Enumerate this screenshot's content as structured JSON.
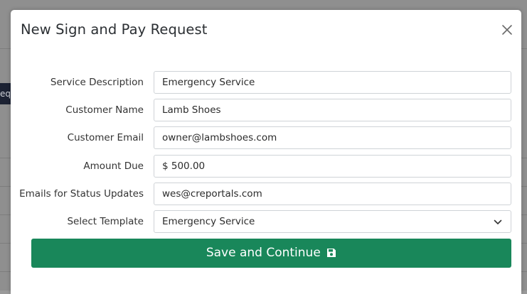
{
  "modal": {
    "title": "New Sign and Pay Request",
    "close_icon": "close-icon"
  },
  "form": {
    "service_description": {
      "label": "Service Description",
      "value": "Emergency Service"
    },
    "customer_name": {
      "label": "Customer Name",
      "value": "Lamb Shoes"
    },
    "customer_email": {
      "label": "Customer Email",
      "value": "owner@lambshoes.com"
    },
    "amount_due": {
      "label": "Amount Due",
      "value": "$ 500.00"
    },
    "status_emails": {
      "label": "Emails for Status Updates",
      "value": "wes@creportals.com"
    },
    "template": {
      "label": "Select Template",
      "selected": "Emergency Service"
    }
  },
  "actions": {
    "save_label": "Save and Continue",
    "save_icon": "floppy-disk-icon"
  },
  "colors": {
    "primary_button": "#19875a",
    "overlay": "#9a9a9a"
  }
}
